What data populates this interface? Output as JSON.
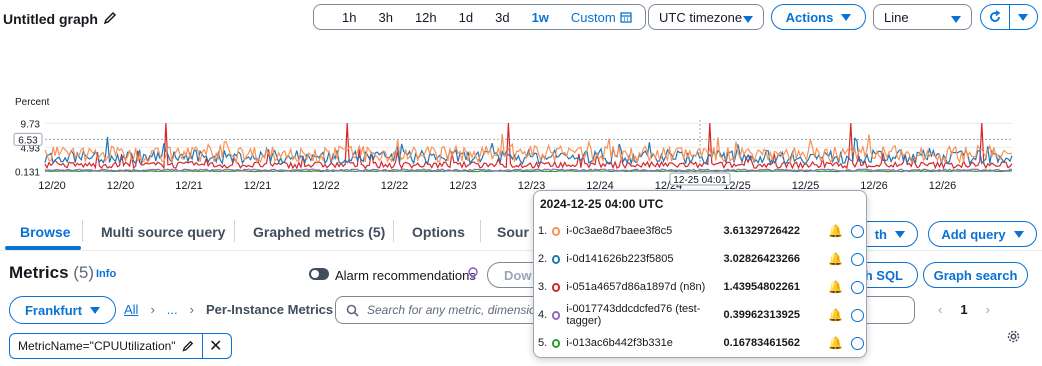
{
  "header": {
    "title": "Untitled graph",
    "ranges": [
      "1h",
      "3h",
      "12h",
      "1d",
      "3d",
      "1w"
    ],
    "active_range": "1w",
    "custom_label": "Custom",
    "timezone": "UTC timezone",
    "actions_label": "Actions",
    "chart_type": "Line"
  },
  "chart_data": {
    "type": "line",
    "ylabel": "Percent",
    "yticks": [
      "9.73",
      "4.93",
      "0.131"
    ],
    "hover_y_label": "6.53",
    "hover_x_label": "12-25 04:01",
    "xticks": [
      "12/20",
      "12/20",
      "12/21",
      "12/21",
      "12/22",
      "12/22",
      "12/23",
      "12/23",
      "12/24",
      "12/24",
      "12/25",
      "12/25",
      "12/26",
      "12/26"
    ],
    "series": [
      {
        "name": "i-0c3ae8d7baee3f8c5",
        "color": "#f89256",
        "base": 3.6
      },
      {
        "name": "i-0d141626b223f5805",
        "color": "#1f77b4",
        "base": 3.0
      },
      {
        "name": "i-051a4657d86a1897d (n8n)",
        "color": "#d62728",
        "base": 1.4
      },
      {
        "name": "i-0017743ddcdcfed76 (test-tagger)",
        "color": "#9467bd",
        "base": 0.4
      },
      {
        "name": "i-013ac6b442f3b331e",
        "color": "#2ca02c",
        "base": 0.17
      }
    ]
  },
  "tooltip": {
    "timestamp": "2024-12-25 04:00 UTC",
    "rows": [
      {
        "num": "1.",
        "name": "i-0c3ae8d7baee3f8c5",
        "value": "3.61329726422",
        "color": "#f89256"
      },
      {
        "num": "2.",
        "name": "i-0d141626b223f5805",
        "value": "3.02826423266",
        "color": "#1f77b4"
      },
      {
        "num": "3.",
        "name": "i-051a4657d86a1897d (n8n)",
        "value": "1.43954802261",
        "color": "#d62728"
      },
      {
        "num": "4.",
        "name": "i-0017743ddcdcfed76 (test-tagger)",
        "value": "0.39962313925",
        "color": "#9467bd"
      },
      {
        "num": "5.",
        "name": "i-013ac6b442f3b331e",
        "value": "0.16783461562",
        "color": "#2ca02c"
      }
    ]
  },
  "tabs": [
    "Browse",
    "Multi source query",
    "Graphed metrics (5)",
    "Options",
    "Sour"
  ],
  "active_tab": "Browse",
  "add_query_label": "Add query",
  "math_partial": "th",
  "metrics": {
    "title": "Metrics",
    "count": "(5)",
    "info": "Info",
    "alarm_rec": "Alarm recommendations",
    "down_partial": "Dow",
    "sql_partial": "h SQL",
    "graph_search": "Graph search",
    "region": "Frankfurt",
    "all_link": "All",
    "ellipsis": "...",
    "breadcrumb_last": "Per-Instance Metrics",
    "search_placeholder": "Search for any metric, dimension",
    "page": "1",
    "filter_token": "MetricName=\"CPUUtilization\""
  }
}
